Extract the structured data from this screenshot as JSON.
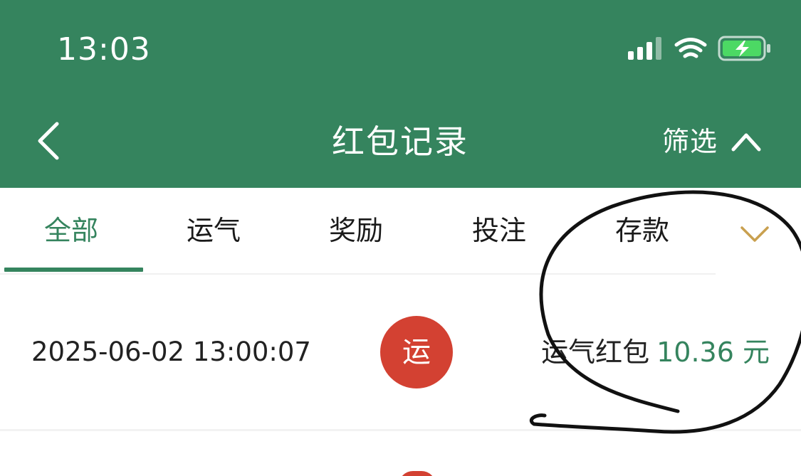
{
  "status_bar": {
    "time": "13:03",
    "signal_icon": "cellular-signal-icon",
    "wifi_icon": "wifi-icon",
    "battery_icon": "battery-charging-icon"
  },
  "nav": {
    "back_icon": "chevron-left-icon",
    "title": "红包记录",
    "filter_label": "筛选",
    "filter_icon": "chevron-up-icon"
  },
  "tabs": [
    {
      "label": "全部",
      "active": true
    },
    {
      "label": "运气",
      "active": false
    },
    {
      "label": "奖励",
      "active": false
    },
    {
      "label": "投注",
      "active": false
    },
    {
      "label": "存款",
      "active": false
    }
  ],
  "tabs_more_icon": "chevron-down-icon",
  "records": [
    {
      "time": "2025-06-02 13:00:07",
      "badge": "运",
      "type": "运气红包",
      "amount": "10.36 元"
    }
  ],
  "colors": {
    "primary": "#35845e",
    "badge": "#d34132",
    "more_chevron": "#c9a04f"
  }
}
